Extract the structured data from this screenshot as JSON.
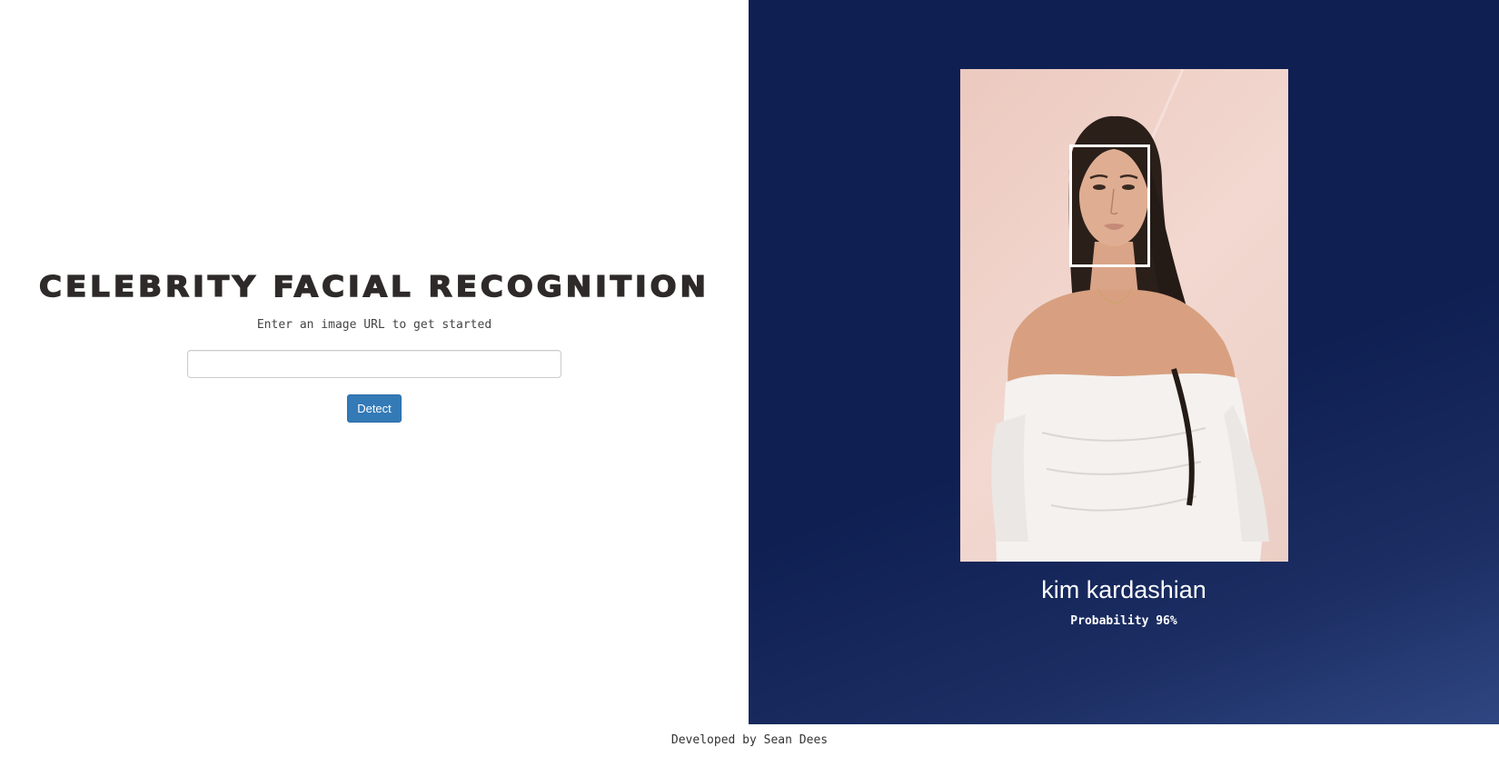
{
  "header": {
    "title": "CELEBRITY FACIAL RECOGNITION",
    "subtitle": "Enter an image URL to get started"
  },
  "form": {
    "url_input_value": "",
    "url_input_placeholder": "",
    "detect_label": "Detect"
  },
  "result": {
    "name": "kim kardashian",
    "probability_label": "Probability",
    "probability_value": "96%"
  },
  "footer": {
    "text": "Developed by Sean Dees"
  },
  "colors": {
    "primary_button": "#337ab7",
    "result_panel_bg": "#0f1f52",
    "face_box": "#ffffff",
    "title_text": "#2e2a2a"
  },
  "icons": []
}
